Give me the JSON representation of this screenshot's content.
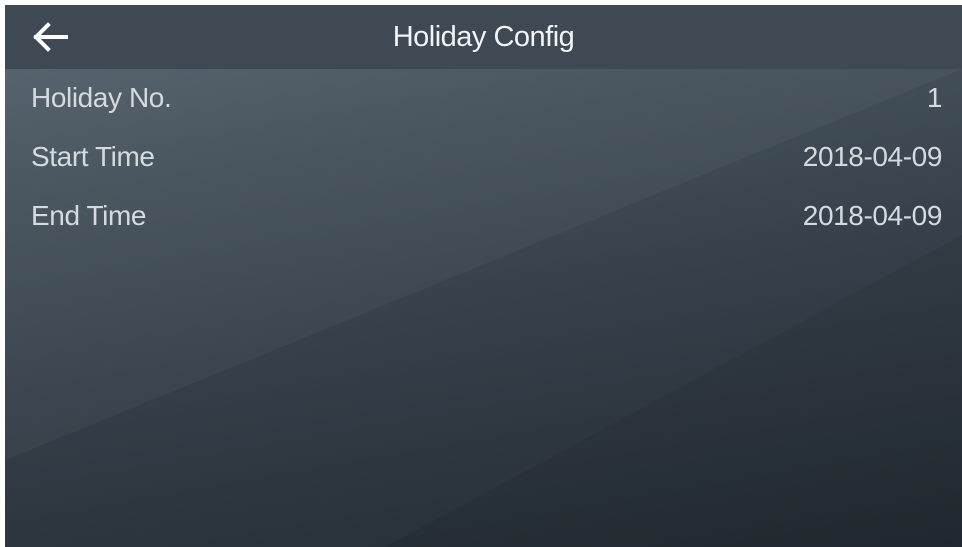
{
  "header": {
    "title": "Holiday Config",
    "back_icon": "arrow-left-icon"
  },
  "fields": [
    {
      "label": "Holiday No.",
      "value": "1"
    },
    {
      "label": "Start Time",
      "value": "2018-04-09"
    },
    {
      "label": "End Time",
      "value": "2018-04-09"
    }
  ],
  "colors": {
    "header_bg": "#3e4953",
    "text": "#d5dade",
    "title_text": "#f2f4f6"
  }
}
